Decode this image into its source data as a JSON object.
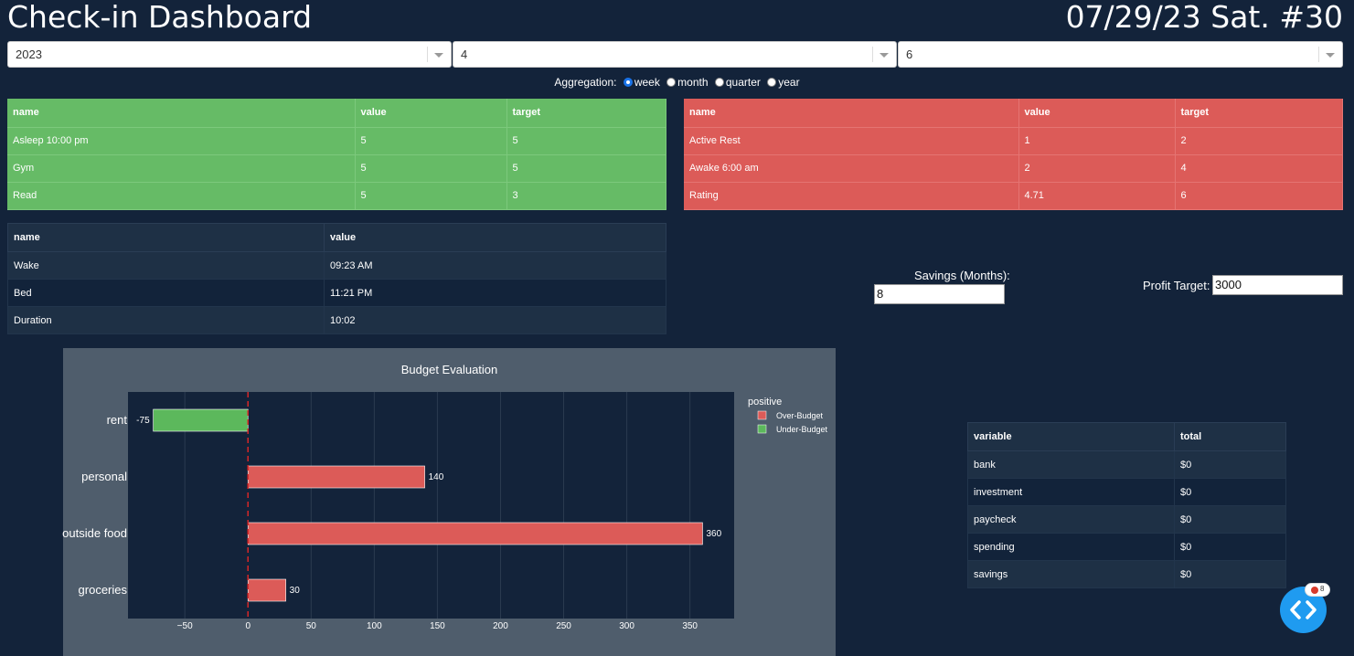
{
  "header": {
    "title": "Check-in Dashboard",
    "date": "07/29/23 Sat. #30"
  },
  "selects": {
    "year": "2023",
    "month": "4",
    "week": "6"
  },
  "aggregation": {
    "label": "Aggregation:",
    "options": [
      "week",
      "month",
      "quarter",
      "year"
    ],
    "selected": "week"
  },
  "green_table": {
    "headers": [
      "name",
      "value",
      "target"
    ],
    "rows": [
      [
        "Asleep 10:00 pm",
        "5",
        "5"
      ],
      [
        "Gym",
        "5",
        "5"
      ],
      [
        "Read",
        "5",
        "3"
      ]
    ]
  },
  "red_table": {
    "headers": [
      "name",
      "value",
      "target"
    ],
    "rows": [
      [
        "Active Rest",
        "1",
        "2"
      ],
      [
        "Awake 6:00 am",
        "2",
        "4"
      ],
      [
        "Rating",
        "4.71",
        "6"
      ]
    ]
  },
  "sleep_table": {
    "headers": [
      "name",
      "value"
    ],
    "rows": [
      [
        "Wake",
        "09:23 AM"
      ],
      [
        "Bed",
        "11:21 PM"
      ],
      [
        "Duration",
        "10:02"
      ]
    ]
  },
  "savings": {
    "label": "Savings (Months):",
    "value": "8"
  },
  "profit": {
    "label": "Profit Target:",
    "value": "3000"
  },
  "totals_table": {
    "headers": [
      "variable",
      "total"
    ],
    "rows": [
      [
        "bank",
        "$0"
      ],
      [
        "investment",
        "$0"
      ],
      [
        "paycheck",
        "$0"
      ],
      [
        "spending",
        "$0"
      ],
      [
        "savings",
        "$0"
      ]
    ]
  },
  "badge": {
    "count": "8"
  },
  "colors": {
    "over": "#dc5b58",
    "under": "#5cb85c",
    "background": "#13233a",
    "chart_bg": "#4f5d6c",
    "plot_bg": "#13233a"
  },
  "chart_data": {
    "type": "bar",
    "orientation": "horizontal",
    "title": "Budget Evaluation",
    "categories": [
      "rent",
      "personal",
      "outside food",
      "groceries"
    ],
    "values": [
      -75,
      140,
      360,
      30
    ],
    "data_labels": [
      "-75",
      "140",
      "360",
      "30"
    ],
    "groups": [
      "Under-Budget",
      "Over-Budget",
      "Over-Budget",
      "Over-Budget"
    ],
    "xlim": [
      -95,
      385
    ],
    "xticks": [
      -50,
      0,
      50,
      100,
      150,
      200,
      250,
      300,
      350
    ],
    "xtick_labels": [
      "−50",
      "0",
      "50",
      "100",
      "150",
      "200",
      "250",
      "300",
      "350"
    ],
    "legend": {
      "title": "positive",
      "entries": [
        "Over-Budget",
        "Under-Budget"
      ],
      "placement": "top-right outside"
    },
    "zero_line": "dashed red",
    "grid": true
  }
}
